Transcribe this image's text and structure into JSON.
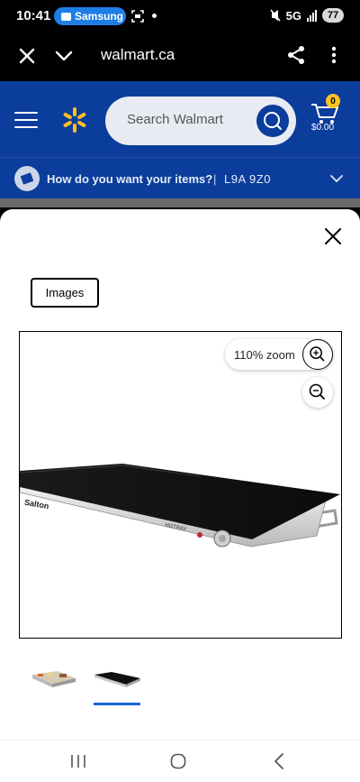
{
  "status_bar": {
    "time": "10:41",
    "notification_app": "Samsung",
    "network": "5G",
    "battery": "77"
  },
  "browser": {
    "url": "walmart.ca"
  },
  "header": {
    "search_placeholder": "Search Walmart",
    "cart_count": "0",
    "cart_total": "$0.00",
    "delivery_question": "How do you want your items?",
    "delivery_separator": "|",
    "postal_code": "L9A 9Z0"
  },
  "modal": {
    "tab_label": "Images",
    "zoom_label": "110% zoom",
    "product_brand": "Salton",
    "product_model": "HOTRAY",
    "selected_thumbnail": 2
  },
  "colors": {
    "walmart_blue": "#0a3d9c",
    "spark_yellow": "#ffc220",
    "accent_blue": "#1a66d6"
  }
}
